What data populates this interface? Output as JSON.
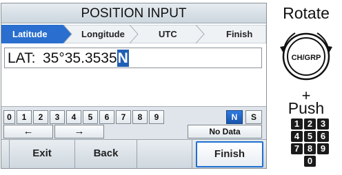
{
  "screen": {
    "title": "POSITION INPUT",
    "steps": [
      {
        "label": "Latitude",
        "active": true
      },
      {
        "label": "Longitude",
        "active": false
      },
      {
        "label": "UTC",
        "active": false
      },
      {
        "label": "Finish",
        "active": false
      }
    ],
    "field": {
      "label": "LAT:",
      "value": "35°35.3535",
      "cursor_char": "N"
    },
    "keypad": {
      "digits": [
        "0",
        "1",
        "2",
        "3",
        "4",
        "5",
        "6",
        "7",
        "8",
        "9"
      ],
      "hemispheres": [
        "N",
        "S"
      ],
      "selected_hemisphere": "N",
      "left_arrow": "←",
      "right_arrow": "→",
      "no_data": "No Data"
    },
    "softkeys": {
      "exit": "Exit",
      "back": "Back",
      "blank": "",
      "finish": "Finish"
    }
  },
  "side": {
    "rotate": "Rotate",
    "knob_label": "CH/GRP",
    "plus": "+",
    "push": "Push",
    "numbers": [
      "1",
      "2",
      "3",
      "4",
      "5",
      "6",
      "7",
      "8",
      "9",
      "0"
    ]
  },
  "colors": {
    "active_step": "#2a6fcf",
    "selected_key": "#1f5fb4",
    "highlight_border": "#1e6fd0"
  }
}
